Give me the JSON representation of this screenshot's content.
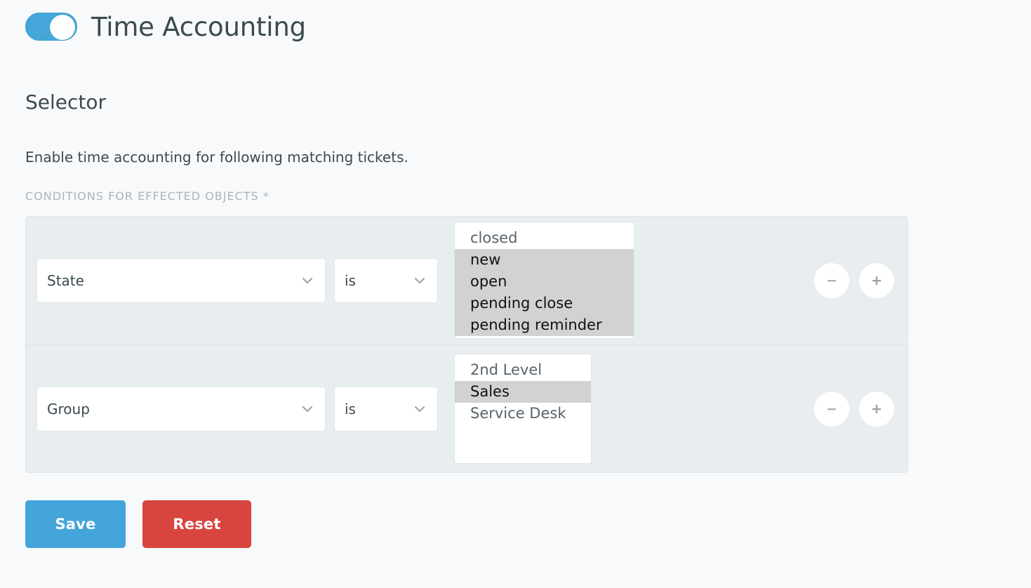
{
  "header": {
    "toggle": {
      "name": "time-accounting-toggle",
      "state": "on"
    },
    "title": "Time Accounting"
  },
  "section": {
    "title": "Selector",
    "description": "Enable time accounting for following matching tickets.",
    "field_label": "CONDITIONS FOR EFFECTED OBJECTS *"
  },
  "conditions": [
    {
      "attribute": "State",
      "operator": "is",
      "options": [
        {
          "label": "closed",
          "selected": false
        },
        {
          "label": "new",
          "selected": true
        },
        {
          "label": "open",
          "selected": true
        },
        {
          "label": "pending close",
          "selected": true
        },
        {
          "label": "pending reminder",
          "selected": true
        }
      ],
      "remove_label": "−",
      "add_label": "+"
    },
    {
      "attribute": "Group",
      "operator": "is",
      "options": [
        {
          "label": "2nd Level",
          "selected": false
        },
        {
          "label": "Sales",
          "selected": true
        },
        {
          "label": "Service Desk",
          "selected": false
        }
      ],
      "remove_label": "−",
      "add_label": "+"
    }
  ],
  "actions": {
    "save_label": "Save",
    "reset_label": "Reset"
  },
  "colors": {
    "page_background": "#f7f9fb",
    "accent_blue": "#43a5d9",
    "danger_red": "#d8453f",
    "panel_background": "#e8edf0",
    "text_dark": "#3b4a51",
    "label_muted": "#a8b5bd",
    "option_selected_background": "#d2d2d2"
  }
}
